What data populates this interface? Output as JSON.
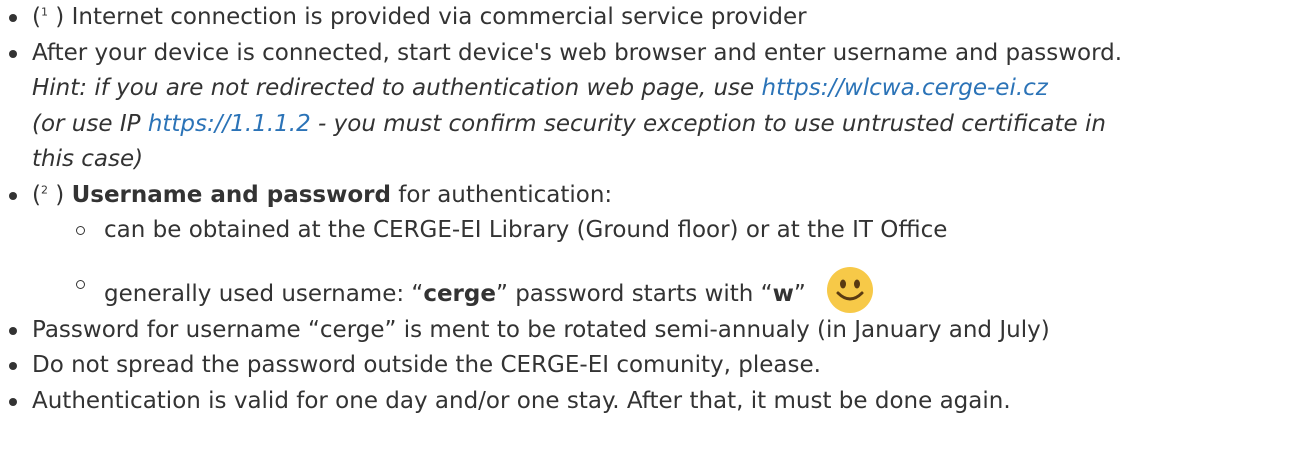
{
  "items": [
    {
      "sup": "1",
      "prefix_open": "(",
      "prefix_close": " )",
      "text": " Internet connection is provided via commercial service provider"
    },
    {
      "text": "After your device is connected, start device's web browser and enter username and password.",
      "hint_line1_pre": "Hint: if you are not redirected to authentication web page, use ",
      "hint_link1": "https://wlcwa.cerge-ei.cz",
      "hint_line2_pre": "(or use IP ",
      "hint_link2": "https://1.1.1.2",
      "hint_line2_post": " - you must confirm security exception to use untrusted certificate in",
      "hint_line3": "this case)"
    },
    {
      "sup": "2",
      "prefix_open": "(",
      "prefix_close": " )",
      "bold": "Username and password",
      "text": " for authentication:",
      "subitems": [
        {
          "text": "can be obtained at the CERGE-EI Library (Ground floor) or at the IT Office"
        },
        {
          "pre": "generally used username: “",
          "bold1": "cerge",
          "mid": "” password starts with “",
          "bold2": "w",
          "post": "”",
          "icon": "smiley-face-icon"
        }
      ]
    },
    {
      "text": "Password for username “cerge” is ment to be rotated semi-annualy (in January and July)"
    },
    {
      "text": "Do not spread the password outside the CERGE-EI comunity, please."
    },
    {
      "text": "Authentication is valid for one day and/or one stay. After that, it must be done again."
    }
  ],
  "colors": {
    "text": "#333333",
    "link": "#2b73b7",
    "smiley_face": "#f7c948",
    "smiley_features": "#5a3b12"
  }
}
